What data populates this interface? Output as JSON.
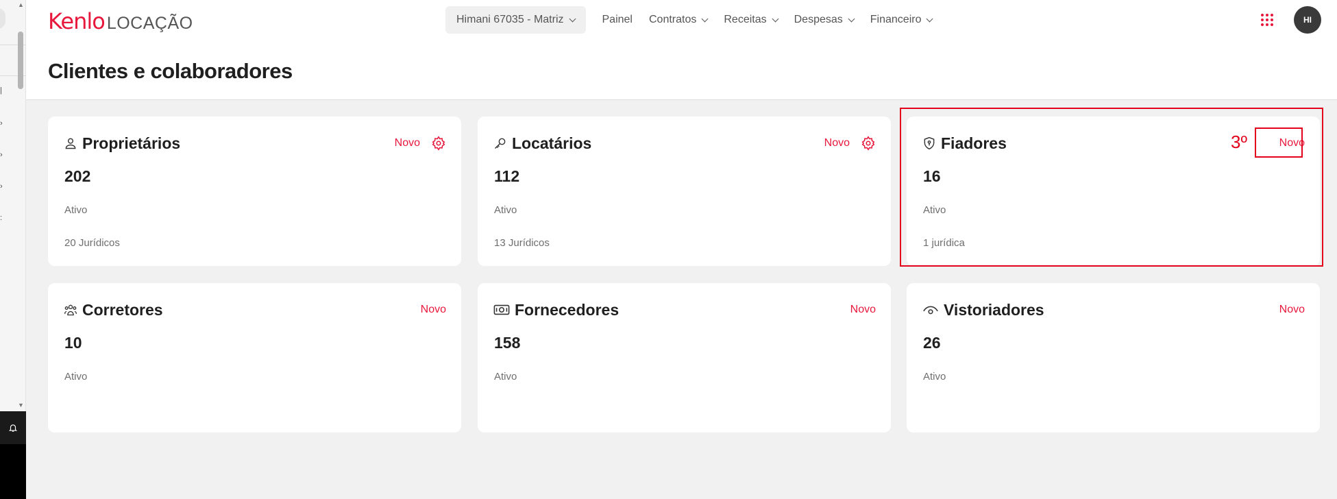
{
  "app": {
    "brand": "Kenlo",
    "product": "LOCAÇÃO",
    "page_title": "Clientes e colaboradores",
    "user_initials": "HI"
  },
  "nav": {
    "account": "Himani 67035 - Matriz",
    "items": [
      {
        "label": "Painel",
        "has_menu": false
      },
      {
        "label": "Contratos",
        "has_menu": true
      },
      {
        "label": "Receitas",
        "has_menu": true
      },
      {
        "label": "Despesas",
        "has_menu": true
      },
      {
        "label": "Financeiro",
        "has_menu": true
      }
    ]
  },
  "cards": [
    {
      "title": "Proprietários",
      "icon": "person-icon",
      "count": "202",
      "status": "Ativo",
      "sub": "20 Jurídicos",
      "action": "Novo",
      "has_settings": true
    },
    {
      "title": "Locatários",
      "icon": "key-icon",
      "count": "112",
      "status": "Ativo",
      "sub": "13 Jurídicos",
      "action": "Novo",
      "has_settings": true
    },
    {
      "title": "Fiadores",
      "icon": "shield-icon",
      "count": "16",
      "status": "Ativo",
      "sub": "1 jurídica",
      "action": "Novo",
      "has_settings": false
    },
    {
      "title": "Corretores",
      "icon": "group-icon",
      "count": "10",
      "status": "Ativo",
      "action": "Novo",
      "has_settings": false
    },
    {
      "title": "Fornecedores",
      "icon": "money-icon",
      "count": "158",
      "status": "Ativo",
      "action": "Novo",
      "has_settings": false
    },
    {
      "title": "Vistoriadores",
      "icon": "eye-icon",
      "count": "26",
      "status": "Ativo",
      "action": "Novo",
      "has_settings": false
    }
  ],
  "annotation": {
    "step_label": "3º",
    "color": "#e3001b"
  },
  "colors": {
    "accent": "#e8173c",
    "background": "#f1f1f1",
    "card": "#ffffff"
  }
}
